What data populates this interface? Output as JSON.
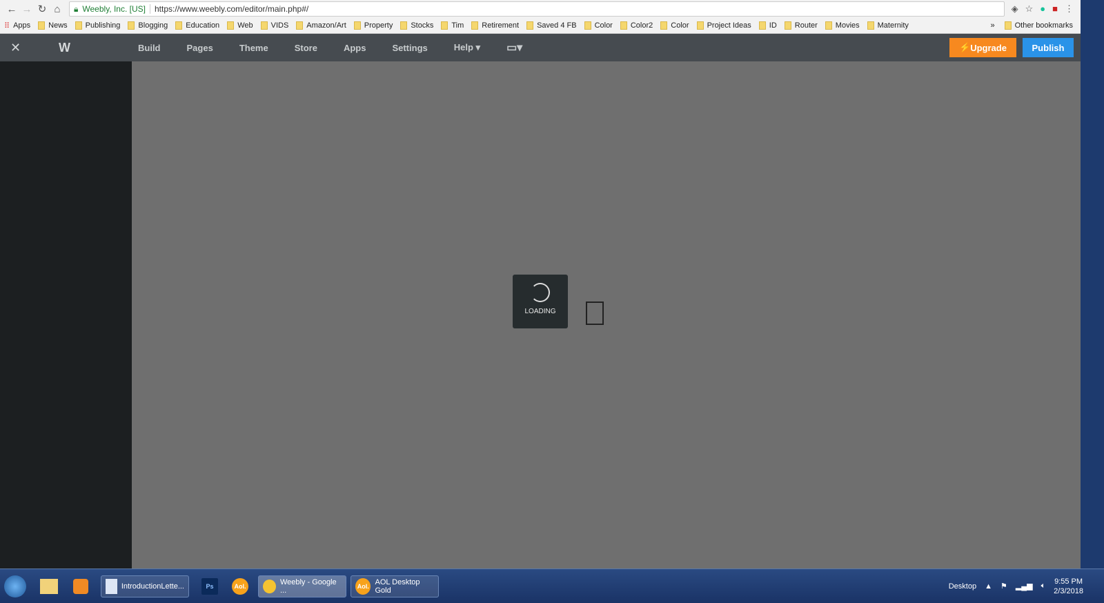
{
  "browser": {
    "site_label": "Weebly, Inc. [US]",
    "url": "https://www.weebly.com/editor/main.php#/",
    "bookmarks": [
      "Apps",
      "News",
      "Publishing",
      "Blogging",
      "Education",
      "Web",
      "VIDS",
      "Amazon/Art",
      "Property",
      "Stocks",
      "Tim",
      "Retirement",
      "Saved 4 FB",
      "Color",
      "Color2",
      "Color",
      "Project Ideas",
      "ID",
      "Router",
      "Movies",
      "Maternity"
    ],
    "more": "»",
    "other_bookmarks": "Other bookmarks"
  },
  "editor": {
    "logo": "W",
    "nav": [
      "Build",
      "Pages",
      "Theme",
      "Store",
      "Apps",
      "Settings",
      "Help"
    ],
    "upgrade": "Upgrade",
    "publish": "Publish",
    "loading": "LOADING",
    "upgrade_color": "#f7891f",
    "publish_color": "#2a93e8"
  },
  "taskbar": {
    "items": [
      "IntroductionLette...",
      "Weebly - Google ...",
      "AOL Desktop Gold"
    ],
    "ps": "Ps",
    "aol": "Aol.",
    "desktop": "Desktop",
    "time": "9:55 PM",
    "date": "2/3/2018"
  }
}
